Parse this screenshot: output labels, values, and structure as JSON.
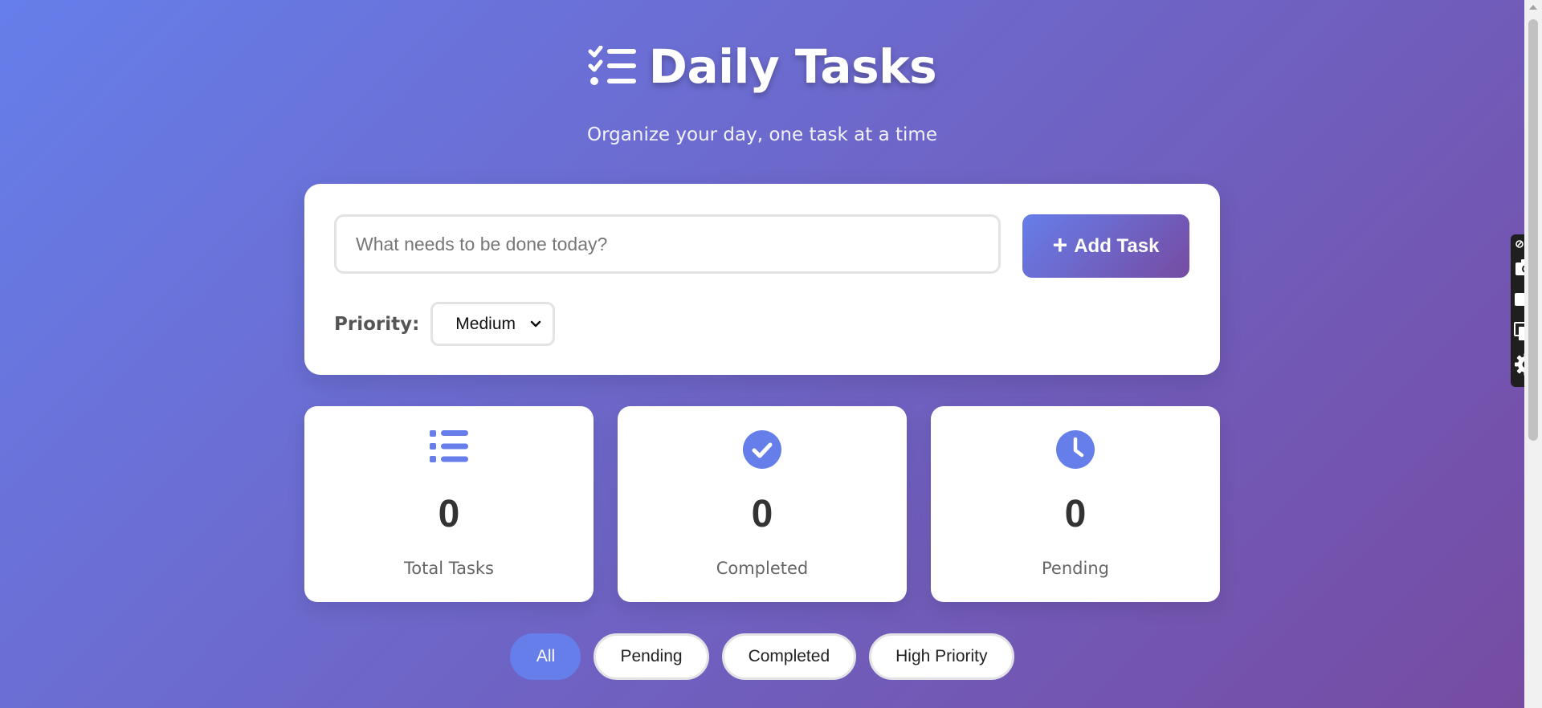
{
  "header": {
    "title": "Daily Tasks",
    "icon": "tasks-list-icon",
    "subtitle": "Organize your day, one task at a time"
  },
  "add_task": {
    "placeholder": "What needs to be done today?",
    "value": "",
    "button_label": "Add Task",
    "button_icon": "plus-icon",
    "priority_label": "Priority:",
    "priority_selected": "Medium"
  },
  "stats": [
    {
      "icon": "list-icon",
      "value": "0",
      "label": "Total Tasks"
    },
    {
      "icon": "check-circle-icon",
      "value": "0",
      "label": "Completed"
    },
    {
      "icon": "clock-icon",
      "value": "0",
      "label": "Pending"
    }
  ],
  "filters": [
    {
      "label": "All",
      "active": true
    },
    {
      "label": "Pending",
      "active": false
    },
    {
      "label": "Completed",
      "active": false
    },
    {
      "label": "High Priority",
      "active": false
    }
  ],
  "toolbar": {
    "items": [
      "link-more-icon",
      "camera-icon",
      "video-icon",
      "windows-icon",
      "gear-icon"
    ]
  },
  "colors": {
    "gradient_start": "#667eea",
    "gradient_end": "#764ba2",
    "accent": "#667eea",
    "card": "#ffffff"
  }
}
